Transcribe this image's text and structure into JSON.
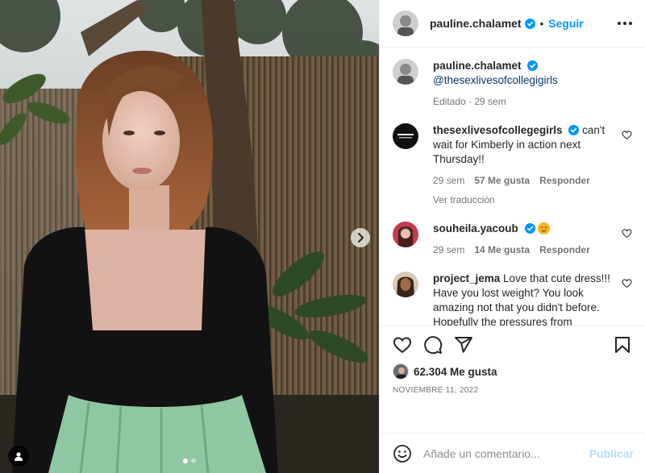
{
  "header": {
    "username": "pauline.chalamet",
    "separator": "•",
    "follow_label": "Seguir"
  },
  "caption": {
    "username": "pauline.chalamet",
    "mention": "@thesexlivesofcollegigirls",
    "meta_edited": "Editado",
    "meta_time": "29 sem"
  },
  "comments": [
    {
      "username": "thesexlivesofcollegegirls",
      "text": " can't wait for Kimberly in action next Thursday!!",
      "time": "29 sem",
      "likes": "57 Me gusta",
      "reply": "Responder",
      "translate": "Ver traducción"
    },
    {
      "username": "souheila.yacoub",
      "text": "",
      "time": "29 sem",
      "likes": "14 Me gusta",
      "reply": "Responder"
    },
    {
      "username": "project_jema",
      "text": " Love that cute dress!!! Have you lost weight? You look amazing not that you didn't before. Hopefully the pressures from Hollywood didn't get to you because you were beautiful before"
    }
  ],
  "likes": {
    "count_label": "62.304 Me gusta"
  },
  "date": "NOVIEMBRE 11, 2022",
  "composer": {
    "placeholder": "Añade un comentario...",
    "publish_label": "Publicar"
  },
  "carousel": {
    "slide_count": 2,
    "active_index": 0
  },
  "icons": {
    "verified": "verified-badge-icon",
    "heart": "heart-icon",
    "comment": "comment-icon",
    "share": "share-icon",
    "save": "bookmark-icon",
    "emoji": "emoji-icon",
    "next": "chevron-right-icon",
    "tag": "user-tag-icon",
    "more": "more-horizontal-icon"
  },
  "colors": {
    "accent": "#0095f6",
    "verified": "#0095f6",
    "mention": "#00376b",
    "muted": "#737373",
    "publish_disabled": "#b2dffc"
  }
}
